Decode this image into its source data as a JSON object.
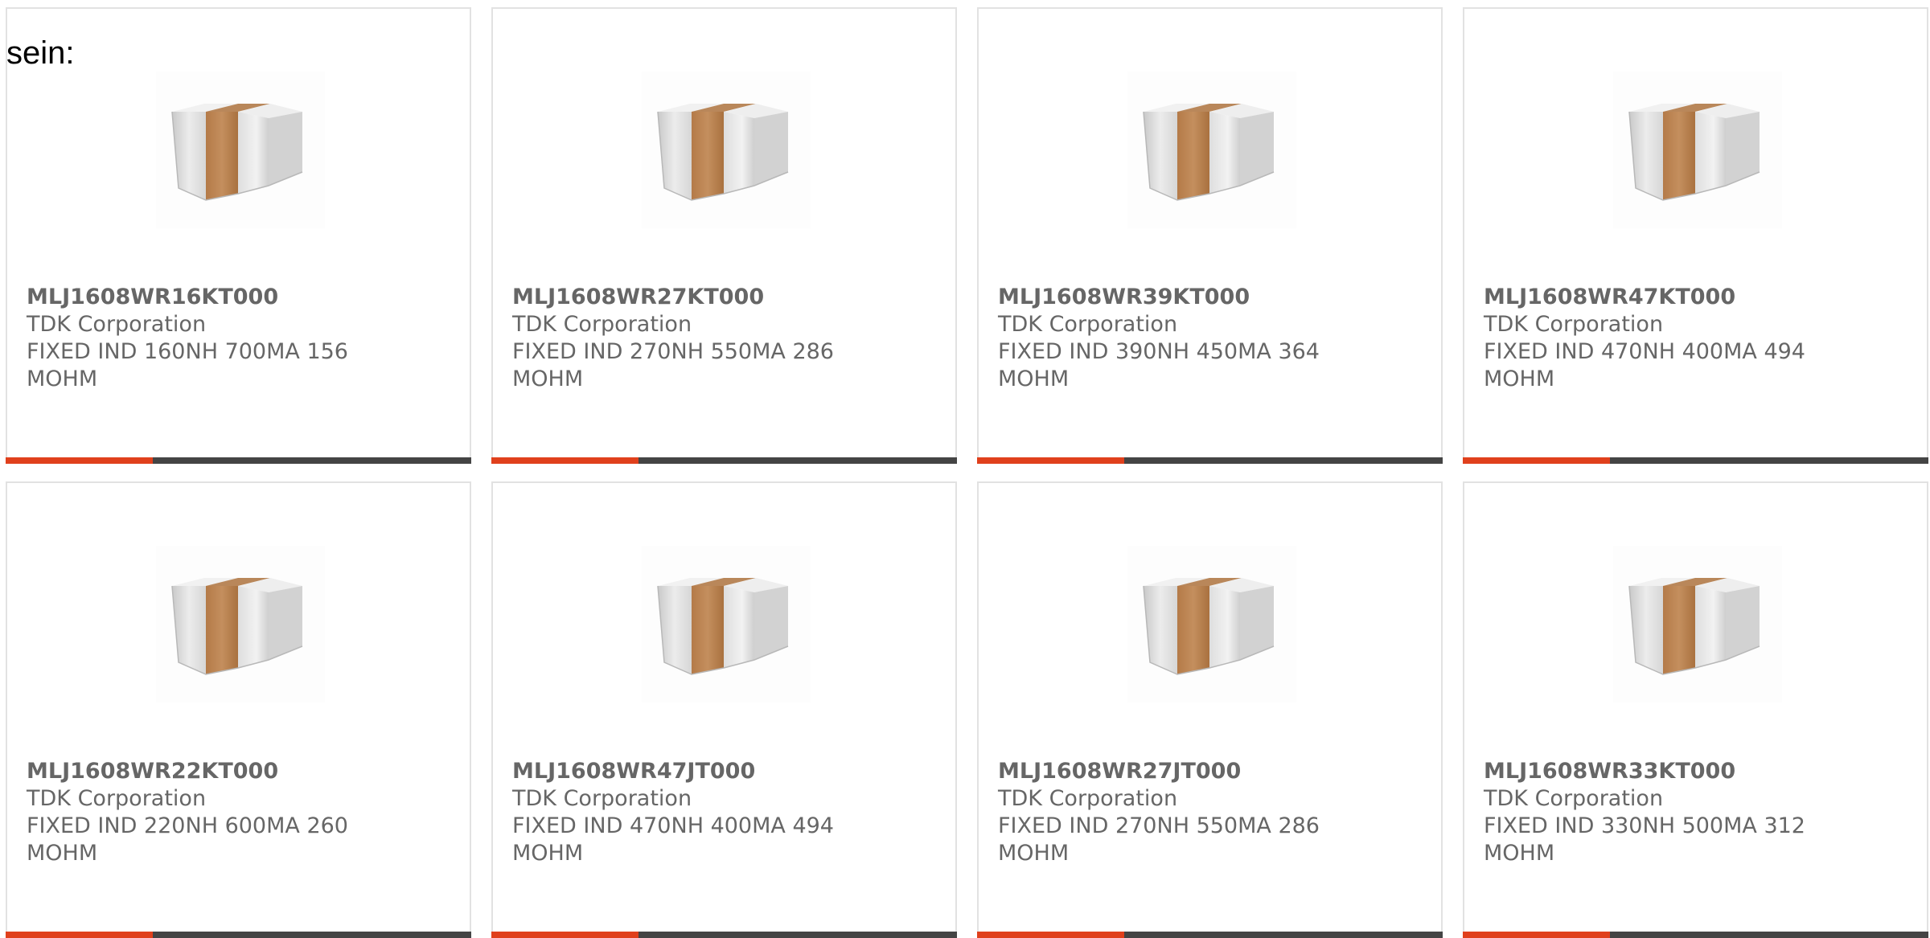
{
  "intro_text": "sein:",
  "accent_color": "#e0401c",
  "bar_color": "#444444",
  "text_color": "#666666",
  "image_icon": "smd-inductor-chip-icon",
  "products": [
    {
      "part_number": "MLJ1608WR16KT000",
      "manufacturer": "TDK Corporation",
      "description": "FIXED IND 160NH 700MA 156 MOHM"
    },
    {
      "part_number": "MLJ1608WR27KT000",
      "manufacturer": "TDK Corporation",
      "description": "FIXED IND 270NH 550MA 286 MOHM"
    },
    {
      "part_number": "MLJ1608WR39KT000",
      "manufacturer": "TDK Corporation",
      "description": "FIXED IND 390NH 450MA 364 MOHM"
    },
    {
      "part_number": "MLJ1608WR47KT000",
      "manufacturer": "TDK Corporation",
      "description": "FIXED IND 470NH 400MA 494 MOHM"
    },
    {
      "part_number": "MLJ1608WR22KT000",
      "manufacturer": "TDK Corporation",
      "description": "FIXED IND 220NH 600MA 260 MOHM"
    },
    {
      "part_number": "MLJ1608WR47JT000",
      "manufacturer": "TDK Corporation",
      "description": "FIXED IND 470NH 400MA 494 MOHM"
    },
    {
      "part_number": "MLJ1608WR27JT000",
      "manufacturer": "TDK Corporation",
      "description": "FIXED IND 270NH 550MA 286 MOHM"
    },
    {
      "part_number": "MLJ1608WR33KT000",
      "manufacturer": "TDK Corporation",
      "description": "FIXED IND 330NH 500MA 312 MOHM"
    }
  ]
}
